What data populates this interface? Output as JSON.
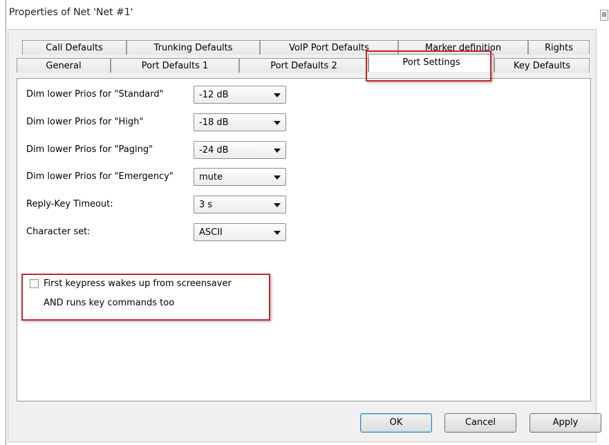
{
  "window": {
    "title": "Properties of Net 'Net #1'",
    "close_glyph": "⊠"
  },
  "tabs": {
    "back_row": [
      "Call Defaults",
      "Trunking Defaults",
      "VoIP Port Defaults",
      "Marker definition",
      "Rights"
    ],
    "front_row": [
      "General",
      "Port Defaults 1",
      "Port Defaults 2",
      "Port Settings",
      "Key Defaults"
    ],
    "active": "Port Settings"
  },
  "settings": [
    {
      "label": "Dim lower Prios for \"Standard\"",
      "value": "-12 dB"
    },
    {
      "label": "Dim lower Prios for \"High\"",
      "value": "-18 dB"
    },
    {
      "label": "Dim lower Prios for \"Paging\"",
      "value": "-24 dB"
    },
    {
      "label": "Dim lower Prios for \"Emergency\"",
      "value": "mute"
    },
    {
      "label": "Reply-Key Timeout:",
      "value": "3 s"
    },
    {
      "label": "Character set:",
      "value": "ASCII"
    }
  ],
  "wake_option": {
    "line1": "First keypress wakes up from screensaver",
    "line2": "AND runs key commands too",
    "checked": false
  },
  "buttons": {
    "ok": "OK",
    "cancel": "Cancel",
    "apply": "Apply"
  },
  "colors": {
    "highlight": "#c0272d",
    "default_button": "#3c7fb1"
  }
}
